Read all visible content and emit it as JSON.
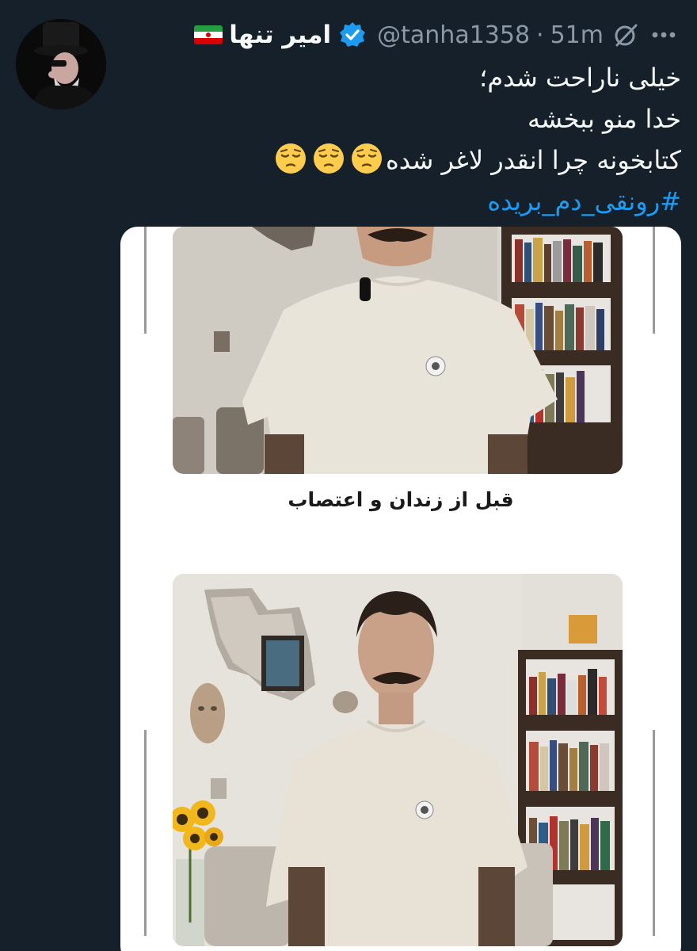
{
  "author": {
    "display_name": "امیر تنها",
    "handle": "@tanha1358",
    "time_sep": "·",
    "time": "51m",
    "verified": true,
    "flag": "Iran flag"
  },
  "actions": {
    "grok_icon": "grok-icon",
    "more_icon": "more-icon"
  },
  "tweet": {
    "line1": "خیلی ناراحت شدم؛",
    "line2": "خدا منو ببخشه",
    "line3": "کتابخونه چرا انقدر لاغر شده",
    "emoji": "pensive-face",
    "hashtag": "#رونقی_دم_بریده"
  },
  "media": {
    "caption_before": "قبل از زندان و اعتصاب"
  },
  "colors": {
    "background": "#15202b",
    "text": "#f7f9f9",
    "muted": "#8b98a5",
    "link": "#1d9bf0",
    "verified": "#1d9bf0"
  }
}
